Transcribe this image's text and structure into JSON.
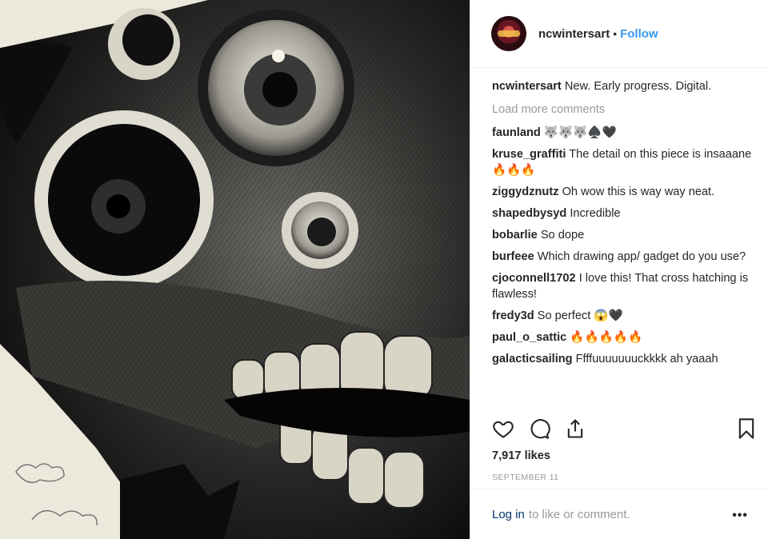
{
  "post": {
    "username": "ncwintersart",
    "follow_label": "Follow",
    "separator": "•",
    "caption_user": "ncwintersart",
    "caption_text": "New. Early progress. Digital.",
    "load_more": "Load more comments",
    "comments": [
      {
        "user": "faunland",
        "text": "🐺🐺🐺♠️🖤"
      },
      {
        "user": "kruse_graffiti",
        "text": "The detail on this piece is insaaane🔥🔥🔥"
      },
      {
        "user": "ziggydznutz",
        "text": "Oh wow this is way way neat."
      },
      {
        "user": "shapedbysyd",
        "text": "Incredible"
      },
      {
        "user": "bobarlie",
        "text": "So dope"
      },
      {
        "user": "burfeee",
        "text": "Which drawing app/ gadget do you use?"
      },
      {
        "user": "cjoconnell1702",
        "text": "I love this! That cross hatching is flawless!"
      },
      {
        "user": "fredy3d",
        "text": "So perfect 😱🖤"
      },
      {
        "user": "paul_o_sattic",
        "text": "🔥🔥🔥🔥🔥"
      },
      {
        "user": "galacticsailing",
        "text": "Ffffuuuuuuuckkkk ah yaaah"
      }
    ],
    "likes": "7,917 likes",
    "date": "SEPTEMBER 11",
    "login_link": "Log in",
    "login_text": "to like or comment.",
    "more_label": "•••"
  },
  "icons": [
    "heart-icon",
    "comment-icon",
    "share-icon",
    "bookmark-icon"
  ],
  "colors": {
    "accent": "#3897f0",
    "muted": "#999999",
    "link": "#003569"
  }
}
